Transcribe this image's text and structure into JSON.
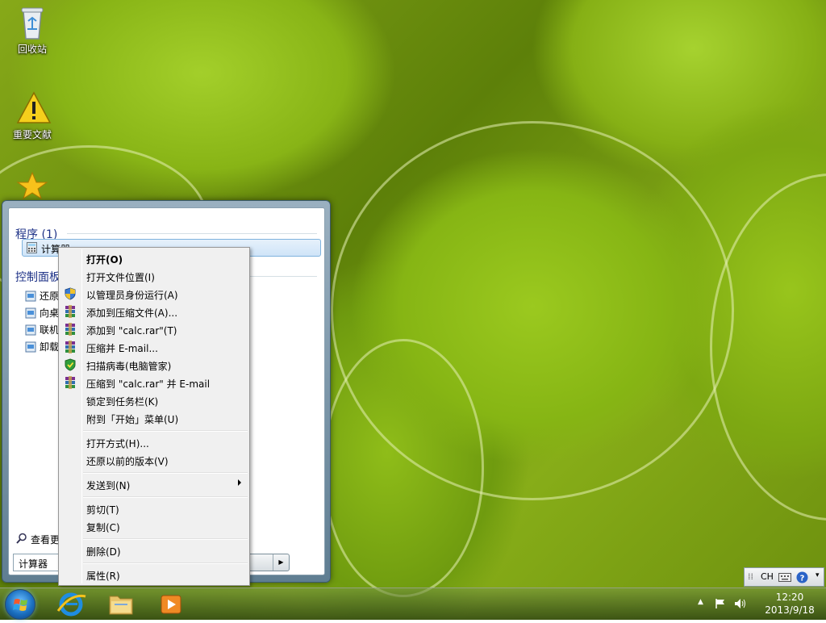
{
  "desktop": {
    "icons": [
      {
        "label": "回收站"
      },
      {
        "label": "重要文献"
      }
    ]
  },
  "start_menu": {
    "programs_title": "程序 (1)",
    "program_item": "计算器",
    "control_panel_title": "控制面板",
    "control_items": [
      "还原",
      "向桌",
      "联机",
      "卸载"
    ],
    "see_more": "查看更",
    "search_value": "计算器"
  },
  "context_menu": {
    "items": [
      {
        "label": "打开(O)",
        "bold": true,
        "icon": ""
      },
      {
        "label": "打开文件位置(I)",
        "icon": ""
      },
      {
        "label": "以管理员身份运行(A)",
        "icon": "uac-shield-icon"
      },
      {
        "label": "添加到压缩文件(A)...",
        "icon": "winrar-icon"
      },
      {
        "label": "添加到 \"calc.rar\"(T)",
        "icon": "winrar-icon"
      },
      {
        "label": "压缩并 E-mail...",
        "icon": "winrar-icon"
      },
      {
        "label": "扫描病毒(电脑管家)",
        "icon": "antivirus-shield-icon"
      },
      {
        "label": "压缩到 \"calc.rar\" 并 E-mail",
        "icon": "winrar-icon"
      },
      {
        "label": "锁定到任务栏(K)",
        "icon": ""
      },
      {
        "label": "附到「开始」菜单(U)",
        "icon": ""
      },
      {
        "label": "打开方式(H)...",
        "icon": ""
      },
      {
        "label": "还原以前的版本(V)",
        "icon": ""
      },
      {
        "label": "发送到(N)",
        "icon": "",
        "submenu": true
      },
      {
        "label": "剪切(T)",
        "icon": ""
      },
      {
        "label": "复制(C)",
        "icon": ""
      },
      {
        "label": "删除(D)",
        "icon": ""
      },
      {
        "label": "属性(R)",
        "icon": ""
      }
    ]
  },
  "language_bar": {
    "lang": "CH"
  },
  "taskbar": {
    "clock_time": "12:20",
    "clock_date": "2013/9/18"
  }
}
